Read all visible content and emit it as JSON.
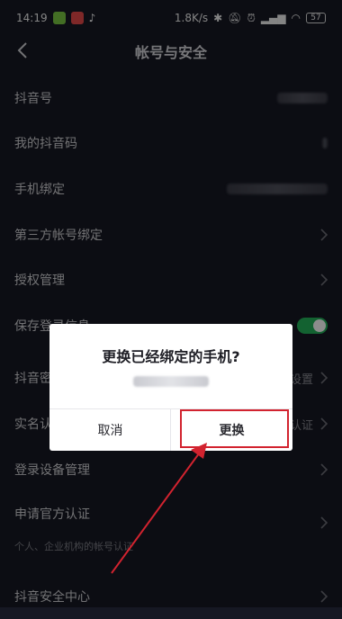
{
  "status": {
    "time": "14:19",
    "network_speed": "1.8K/s",
    "battery": "57",
    "icons": [
      "app-green-icon",
      "app-red-icon",
      "tiktok-icon",
      "bluetooth-icon",
      "mute-icon",
      "alarm-icon",
      "signal-icon",
      "wifi-icon",
      "battery-icon"
    ]
  },
  "header": {
    "title": "帐号与安全",
    "back_icon": "chevron-left-icon"
  },
  "rows": [
    {
      "label": "抖音号"
    },
    {
      "label": "我的抖音码"
    },
    {
      "label": "手机绑定"
    },
    {
      "label": "第三方帐号绑定"
    },
    {
      "label": "授权管理"
    },
    {
      "label": "保存登录信息"
    },
    {
      "label": "抖音密码",
      "right_text": "设置"
    },
    {
      "label": "实名认证",
      "right_text": "认证"
    },
    {
      "label": "登录设备管理"
    },
    {
      "label": "申请官方认证",
      "subtitle": "个人、企业机构的帐号认证"
    },
    {
      "label": "抖音安全中心"
    }
  ],
  "dialog": {
    "title": "更换已经绑定的手机?",
    "cancel_label": "取消",
    "confirm_label": "更换"
  },
  "colors": {
    "background": "#161823",
    "toggle_on": "#23b35a",
    "annotation": "#d2232f"
  }
}
